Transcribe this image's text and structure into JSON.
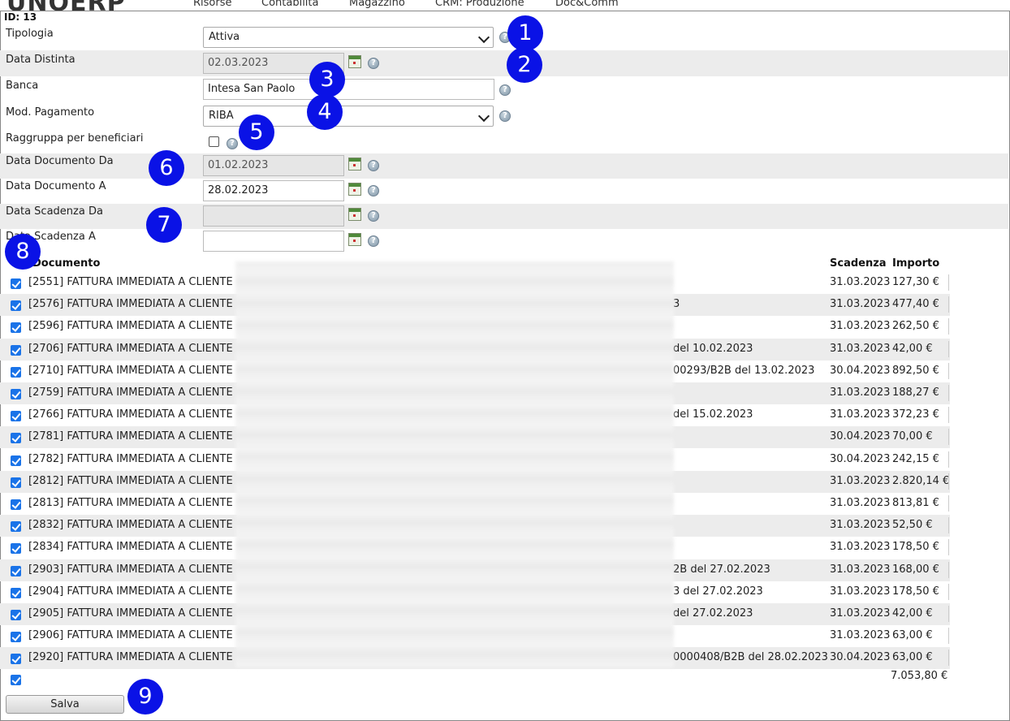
{
  "app": {
    "logo": "UNOERP",
    "menu": [
      "Risorse",
      "Contabilità",
      "Magazzino",
      "CRM: Produzione",
      "Doc&Comm"
    ]
  },
  "dialog": {
    "id_label": "ID: 13"
  },
  "form": {
    "tipologia": {
      "label": "Tipologia",
      "value": "Attiva"
    },
    "data_distinta": {
      "label": "Data Distinta",
      "value": "02.03.2023"
    },
    "banca": {
      "label": "Banca",
      "value": "Intesa San Paolo"
    },
    "mod_pagamento": {
      "label": "Mod. Pagamento",
      "value": "RIBA"
    },
    "raggruppa": {
      "label": "Raggruppa per beneficiari",
      "checked": false
    },
    "data_doc_da": {
      "label": "Data Documento Da",
      "value": "01.02.2023"
    },
    "data_doc_a": {
      "label": "Data Documento A",
      "value": "28.02.2023"
    },
    "data_scad_da": {
      "label": "Data Scadenza Da",
      "value": ""
    },
    "data_scad_a": {
      "label": "Data Scadenza A",
      "value": ""
    },
    "help_glyph": "?"
  },
  "table": {
    "headers": {
      "documento": "Documento",
      "scadenza": "Scadenza",
      "importo": "Importo"
    },
    "rows": [
      {
        "doc": "[2551] FATTURA IMMEDIATA A CLIENTE",
        "tail": "",
        "scadenza": "31.03.2023",
        "importo": "127,30 €"
      },
      {
        "doc": "[2576] FATTURA IMMEDIATA A CLIENTE",
        "tail": "3",
        "scadenza": "31.03.2023",
        "importo": "477,40 €"
      },
      {
        "doc": "[2596] FATTURA IMMEDIATA A CLIENTE",
        "tail": "",
        "scadenza": "31.03.2023",
        "importo": "262,50 €"
      },
      {
        "doc": "[2706] FATTURA IMMEDIATA A CLIENTE",
        "tail": "del 10.02.2023",
        "scadenza": "31.03.2023",
        "importo": "42,00 €"
      },
      {
        "doc": "[2710] FATTURA IMMEDIATA A CLIENTE",
        "tail": "00293/B2B del 13.02.2023",
        "scadenza": "30.04.2023",
        "importo": "892,50 €"
      },
      {
        "doc": "[2759] FATTURA IMMEDIATA A CLIENTE",
        "tail": "",
        "scadenza": "31.03.2023",
        "importo": "188,27 €"
      },
      {
        "doc": "[2766] FATTURA IMMEDIATA A CLIENTE",
        "tail": "del 15.02.2023",
        "scadenza": "31.03.2023",
        "importo": "372,23 €"
      },
      {
        "doc": "[2781] FATTURA IMMEDIATA A CLIENTE",
        "tail": "",
        "scadenza": "30.04.2023",
        "importo": "70,00 €"
      },
      {
        "doc": "[2782] FATTURA IMMEDIATA A CLIENTE",
        "tail": "",
        "scadenza": "30.04.2023",
        "importo": "242,15 €"
      },
      {
        "doc": "[2812] FATTURA IMMEDIATA A CLIENTE",
        "tail": "",
        "scadenza": "31.03.2023",
        "importo": "2.820,14 €"
      },
      {
        "doc": "[2813] FATTURA IMMEDIATA A CLIENTE",
        "tail": "",
        "scadenza": "31.03.2023",
        "importo": "813,81 €"
      },
      {
        "doc": "[2832] FATTURA IMMEDIATA A CLIENTE",
        "tail": "",
        "scadenza": "31.03.2023",
        "importo": "52,50 €"
      },
      {
        "doc": "[2834] FATTURA IMMEDIATA A CLIENTE",
        "tail": "",
        "scadenza": "31.03.2023",
        "importo": "178,50 €"
      },
      {
        "doc": "[2903] FATTURA IMMEDIATA A CLIENTE",
        "tail": "2B del 27.02.2023",
        "scadenza": "31.03.2023",
        "importo": "168,00 €"
      },
      {
        "doc": "[2904] FATTURA IMMEDIATA A CLIENTE",
        "tail": "3 del 27.02.2023",
        "scadenza": "31.03.2023",
        "importo": "178,50 €"
      },
      {
        "doc": "[2905] FATTURA IMMEDIATA A CLIENTE",
        "tail": "del 27.02.2023",
        "scadenza": "31.03.2023",
        "importo": "42,00 €"
      },
      {
        "doc": "[2906] FATTURA IMMEDIATA A CLIENTE",
        "tail": "",
        "scadenza": "31.03.2023",
        "importo": "63,00 €"
      },
      {
        "doc": "[2920] FATTURA IMMEDIATA A CLIENTE",
        "tail": "0000408/B2B del 28.02.2023",
        "scadenza": "30.04.2023",
        "importo": "63,00 €"
      }
    ],
    "total": "7.053,80 €"
  },
  "actions": {
    "save_label": "Salva"
  },
  "annotations": [
    "1",
    "2",
    "3",
    "4",
    "5",
    "6",
    "7",
    "8",
    "9"
  ]
}
